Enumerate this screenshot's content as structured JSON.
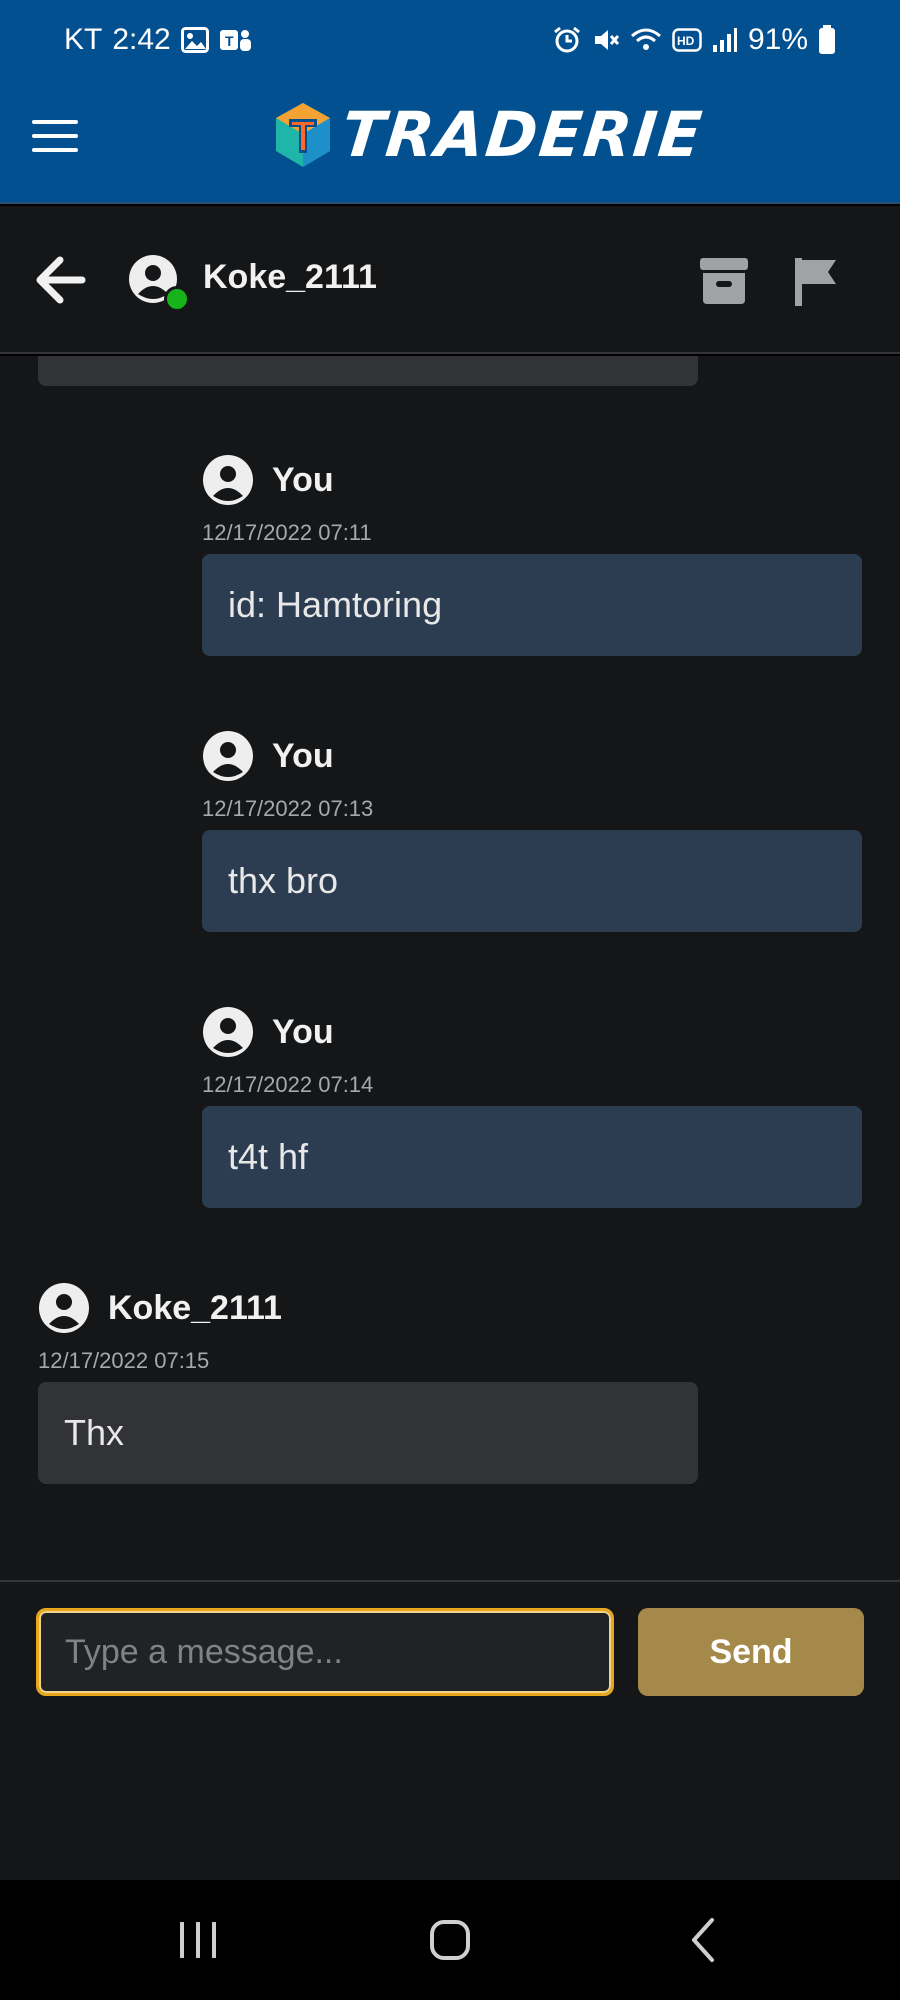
{
  "status_bar": {
    "carrier": "KT",
    "time": "2:42",
    "battery": "91%",
    "left_icons": [
      "gallery-icon",
      "teams-icon"
    ],
    "right_icons": [
      "alarm-icon",
      "mute-icon",
      "wifi-icon",
      "hd-icon",
      "signal-icon",
      "battery-icon"
    ]
  },
  "header": {
    "logo_text": "TRADERIE",
    "menu_icon": "hamburger-menu-icon"
  },
  "chat": {
    "partner_name": "Koke_2111",
    "online": true,
    "actions": [
      "archive-icon",
      "flag-icon"
    ]
  },
  "messages": [
    {
      "sender": "You",
      "time": "12/17/2022 07:11",
      "text": "id: Hamtoring",
      "own": true
    },
    {
      "sender": "You",
      "time": "12/17/2022 07:13",
      "text": "thx bro",
      "own": true
    },
    {
      "sender": "You",
      "time": "12/17/2022 07:14",
      "text": "t4t hf",
      "own": true
    },
    {
      "sender": "Koke_2111",
      "time": "12/17/2022 07:15",
      "text": "Thx",
      "own": false
    }
  ],
  "composer": {
    "placeholder": "Type a message...",
    "value": "",
    "send_label": "Send"
  },
  "colors": {
    "header_blue": "#02508f",
    "background": "#151618",
    "own_bubble": "#2c3d52",
    "their_bubble": "#323336",
    "send_button": "#a5894a",
    "input_focus": "#e8a81d",
    "online": "#17b31b"
  }
}
